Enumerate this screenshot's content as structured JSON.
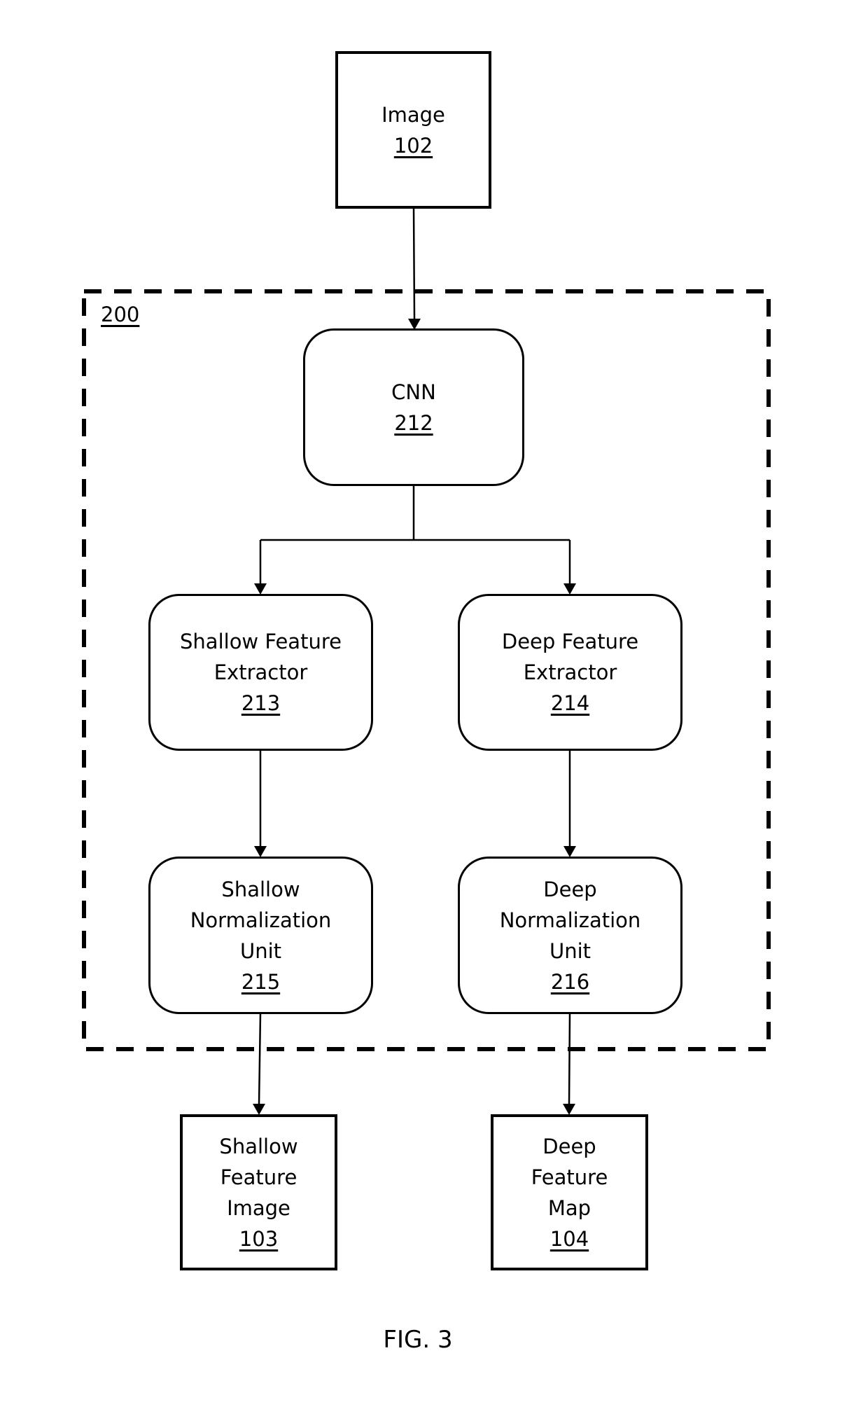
{
  "diagram": {
    "container": {
      "ref": "200"
    },
    "nodes": {
      "image": {
        "label": "Image",
        "ref": "102"
      },
      "cnn": {
        "label": "CNN",
        "ref": "212"
      },
      "shallow_extractor": {
        "lines": [
          "Shallow Feature",
          "Extractor"
        ],
        "ref": "213"
      },
      "deep_extractor": {
        "lines": [
          "Deep Feature",
          "Extractor"
        ],
        "ref": "214"
      },
      "shallow_norm": {
        "lines": [
          "Shallow",
          "Normalization",
          "Unit"
        ],
        "ref": "215"
      },
      "deep_norm": {
        "lines": [
          "Deep",
          "Normalization",
          "Unit"
        ],
        "ref": "216"
      },
      "shallow_image": {
        "lines": [
          "Shallow",
          "Feature",
          "Image"
        ],
        "ref": "103"
      },
      "deep_map": {
        "lines": [
          "Deep",
          "Feature",
          "Map"
        ],
        "ref": "104"
      }
    },
    "edges": [
      [
        "image",
        "cnn"
      ],
      [
        "cnn",
        "shallow_extractor"
      ],
      [
        "cnn",
        "deep_extractor"
      ],
      [
        "shallow_extractor",
        "shallow_norm"
      ],
      [
        "deep_extractor",
        "deep_norm"
      ],
      [
        "shallow_norm",
        "shallow_image"
      ],
      [
        "deep_norm",
        "deep_map"
      ]
    ],
    "caption": "FIG. 3"
  }
}
